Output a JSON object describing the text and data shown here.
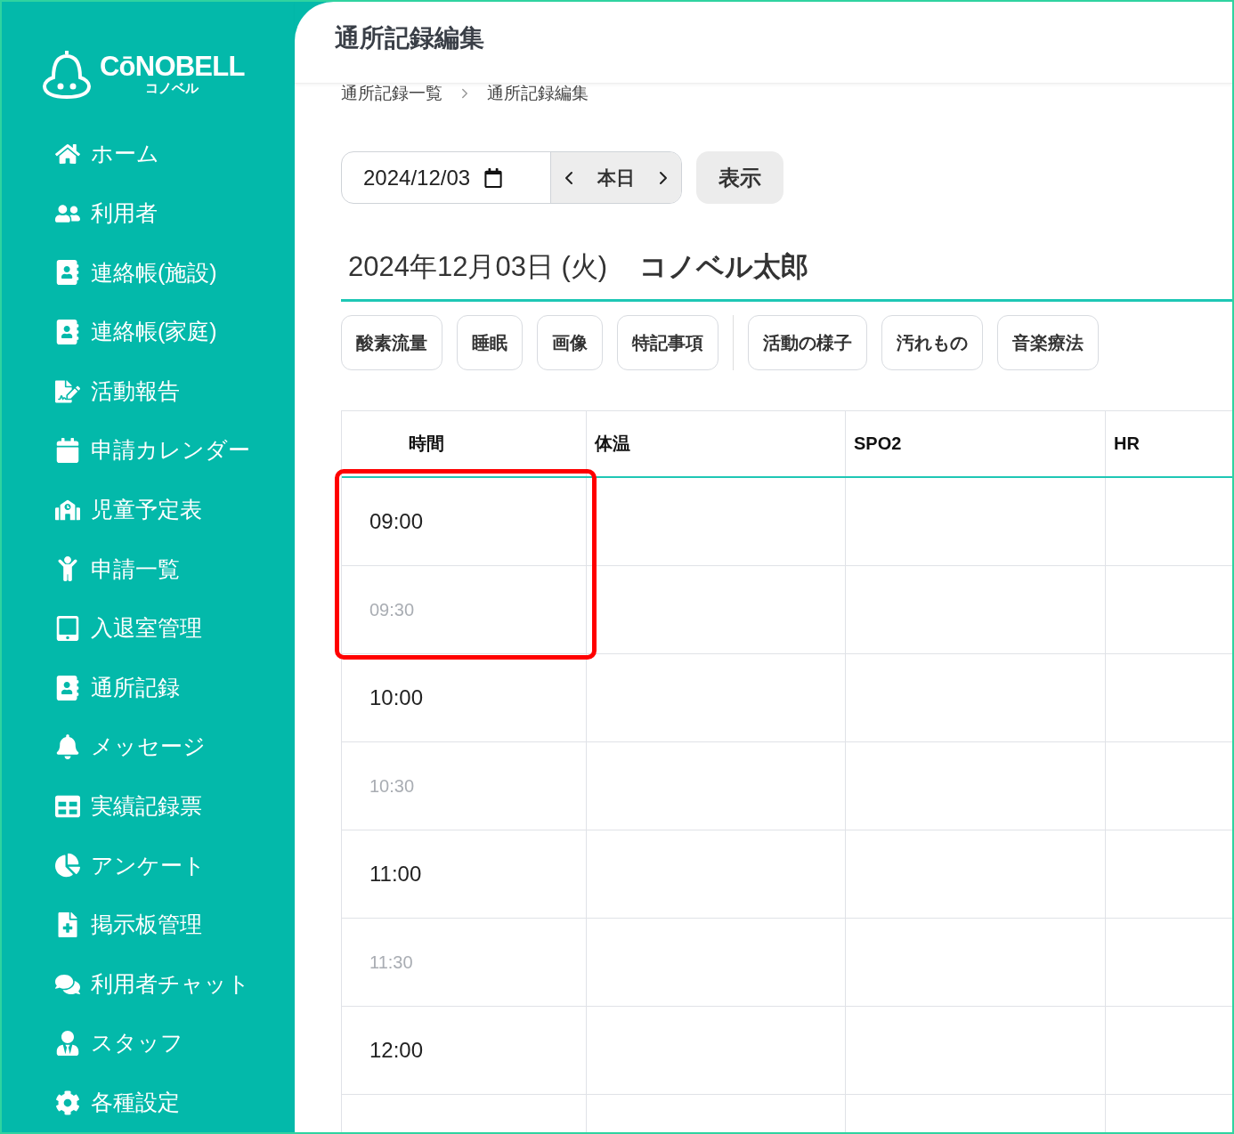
{
  "logo": {
    "name": "CōNOBELL",
    "subtitle": "コノベル"
  },
  "sidebar": {
    "items": [
      {
        "label": "ホーム"
      },
      {
        "label": "利用者"
      },
      {
        "label": "連絡帳(施設)"
      },
      {
        "label": "連絡帳(家庭)"
      },
      {
        "label": "活動報告"
      },
      {
        "label": "申請カレンダー"
      },
      {
        "label": "児童予定表"
      },
      {
        "label": "申請一覧"
      },
      {
        "label": "入退室管理"
      },
      {
        "label": "通所記録"
      },
      {
        "label": "メッセージ"
      },
      {
        "label": "実績記録票"
      },
      {
        "label": "アンケート"
      },
      {
        "label": "掲示板管理"
      },
      {
        "label": "利用者チャット"
      },
      {
        "label": "スタッフ"
      },
      {
        "label": "各種設定"
      }
    ]
  },
  "page_title": "通所記録編集",
  "breadcrumb": [
    "通所記録一覧",
    "通所記録編集"
  ],
  "date_picker": {
    "value": "2024/12/03",
    "today_label": "本日"
  },
  "show_button": "表示",
  "record_heading": {
    "date": "2024年12月03日 (火)",
    "name": "コノベル太郎"
  },
  "record_tab_groups": [
    [
      "酸素流量",
      "睡眠",
      "画像",
      "特記事項"
    ],
    [
      "活動の様子",
      "汚れもの",
      "音楽療法"
    ]
  ],
  "table": {
    "columns": [
      "時間",
      "体温",
      "SPO2",
      "HR"
    ],
    "rows": [
      {
        "time": "09:00",
        "kind": "hour"
      },
      {
        "time": "09:30",
        "kind": "half"
      },
      {
        "time": "10:00",
        "kind": "hour"
      },
      {
        "time": "10:30",
        "kind": "half"
      },
      {
        "time": "11:00",
        "kind": "hour"
      },
      {
        "time": "11:30",
        "kind": "half"
      },
      {
        "time": "12:00",
        "kind": "hour"
      }
    ]
  }
}
